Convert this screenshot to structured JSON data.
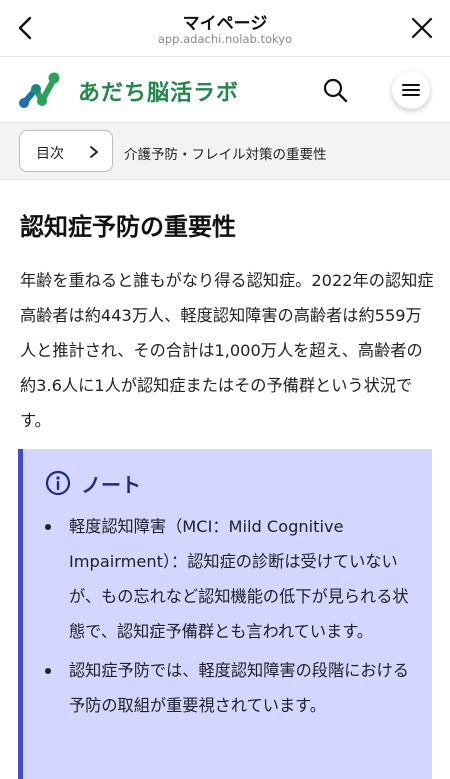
{
  "browser": {
    "title": "マイページ",
    "url": "app.adachi.nolab.tokyo"
  },
  "site": {
    "brand": "あだち脳活ラボ",
    "brand_color": "#1e8a4a"
  },
  "toc": {
    "button_label": "目次",
    "breadcrumb": "介護予防・フレイル対策の重要性"
  },
  "article": {
    "heading": "認知症予防の重要性",
    "paragraph": "年齢を重ねると誰もがなり得る認知症。2022年の認知症高齢者は約443万人、軽度認知障害の高齢者は約559万人と推計され、その合計は1,000万人を超え、高齢者の約3.6人に1人が認知症またはその予備群という状況です。"
  },
  "note": {
    "title": "ノート",
    "bg_color": "#d3d6ff",
    "accent_color": "#3f4bd8",
    "items": [
      "軽度認知障害（MCI：Mild Cognitive Impairment）：認知症の診断は受けていないが、もの忘れなど認知機能の低下が見られる状態で、認知症予備群とも言われています。",
      "認知症予防では、軽度認知障害の段階における予防の取組が重要視されています。"
    ]
  },
  "icons": {
    "back": "chevron-left-icon",
    "close": "close-icon",
    "search": "search-icon",
    "menu": "hamburger-menu-icon",
    "toc_chevron": "chevron-right-icon",
    "note_info": "info-circle-icon",
    "logo": "brand-logo-icon"
  }
}
